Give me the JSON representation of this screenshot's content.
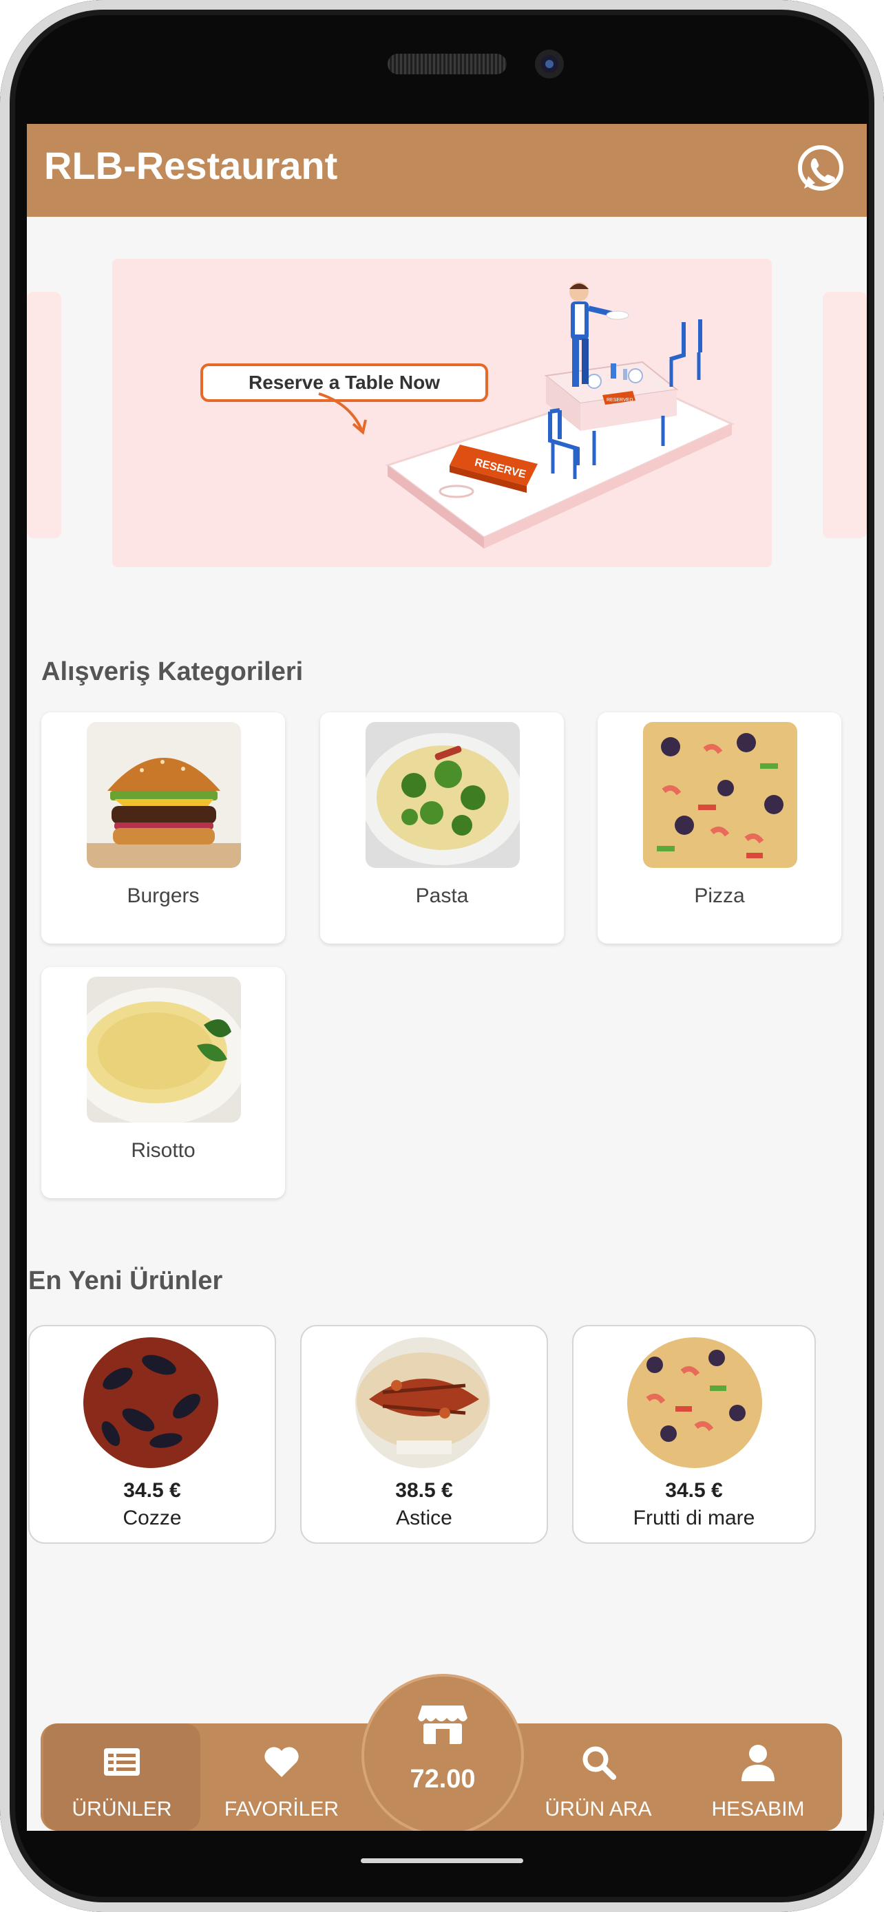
{
  "app": {
    "title": "RLB-Restaurant"
  },
  "banner": {
    "headline": "Reserve a Table Now",
    "button_label": "RESERVE",
    "sign_label": "RESERVED"
  },
  "categories": {
    "title": "Alışveriş Kategorileri",
    "items": [
      {
        "label": "Burgers"
      },
      {
        "label": "Pasta"
      },
      {
        "label": "Pizza"
      },
      {
        "label": "Risotto"
      }
    ]
  },
  "newest": {
    "title": "En Yeni Ürünler",
    "items": [
      {
        "price": "34.5 €",
        "name": "Cozze"
      },
      {
        "price": "38.5 €",
        "name": "Astice"
      },
      {
        "price": "34.5 €",
        "name": "Frutti di mare"
      }
    ]
  },
  "nav": {
    "products": "ÜRÜNLER",
    "favorites": "FAVORİLER",
    "cart_total": "72.00",
    "search": "ÜRÜN ARA",
    "account": "HESABIM"
  },
  "colors": {
    "brand": "#c08a5a",
    "brand_active": "#b27d52",
    "banner_bg": "#fde5e5",
    "accent_orange": "#e56a2a"
  }
}
